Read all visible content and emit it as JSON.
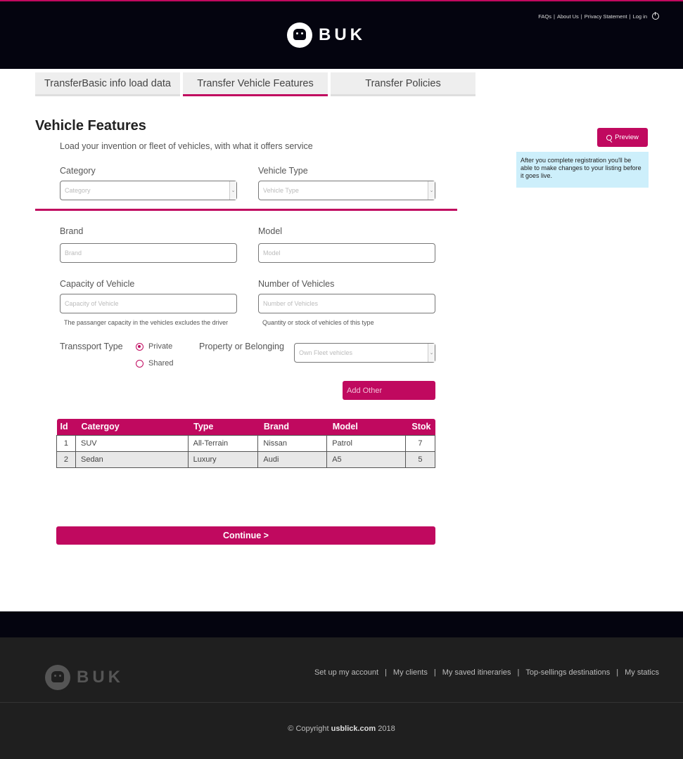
{
  "header": {
    "logo_text": "BUK",
    "top_links": [
      "FAQs",
      "About Us",
      "Privacy Statement",
      "Log in"
    ]
  },
  "tabs": [
    {
      "label": "TransferBasic info load data",
      "active": false
    },
    {
      "label": "Transfer Vehicle Features",
      "active": true
    },
    {
      "label": "Transfer Policies",
      "active": false
    }
  ],
  "main": {
    "title": "Vehicle Features",
    "subtitle": "Load your invention or fleet of vehicles, with what it offers service",
    "category": {
      "label": "Category",
      "placeholder": "Category"
    },
    "vehicle_type": {
      "label": "Vehicle Type",
      "placeholder": "Vehicle Type"
    },
    "brand": {
      "label": "Brand",
      "placeholder": "Brand"
    },
    "model": {
      "label": "Model",
      "placeholder": "Model"
    },
    "capacity": {
      "label": "Capacity of Vehicle",
      "placeholder": "Capacity of Vehicle",
      "hint": "The passanger capacity in the vehicles excludes the driver"
    },
    "number": {
      "label": "Number of Vehicles",
      "placeholder": "Number of Vehicles",
      "hint": "Quantity or stock of vehicles of this type"
    },
    "transport_type": {
      "label": "Transsport Type",
      "options": [
        "Private",
        "Shared"
      ],
      "selected": "Private"
    },
    "property": {
      "label": "Property or Belonging",
      "value": "Own Fleet vehicles"
    },
    "add_other_label": "Add Other",
    "continue_label": "Continue >"
  },
  "table": {
    "headers": [
      "Id",
      "Catergoy",
      "Type",
      "Brand",
      "Model",
      "Stok"
    ],
    "rows": [
      [
        "1",
        "SUV",
        "All-Terrain",
        "Nissan",
        "Patrol",
        "7"
      ],
      [
        "2",
        "Sedan",
        "Luxury",
        "Audi",
        "A5",
        "5"
      ]
    ]
  },
  "sidebar": {
    "preview_label": "Preview",
    "info_text": "After you complete registration you'll be able to make changes to your listing before it goes live."
  },
  "footer": {
    "logo_text": "BUK",
    "links": [
      "Set up my account",
      "My clients",
      "My saved itineraries",
      "Top-sellings destinations",
      "My statics"
    ],
    "copyright_prefix": "© Copyright",
    "copyright_site": "usblick.com",
    "copyright_year": "2018"
  },
  "colors": {
    "accent": "#c0095f",
    "header_bg": "#04040f",
    "footer_bg": "#1f1f1f",
    "info_bg": "#cdeffb"
  }
}
